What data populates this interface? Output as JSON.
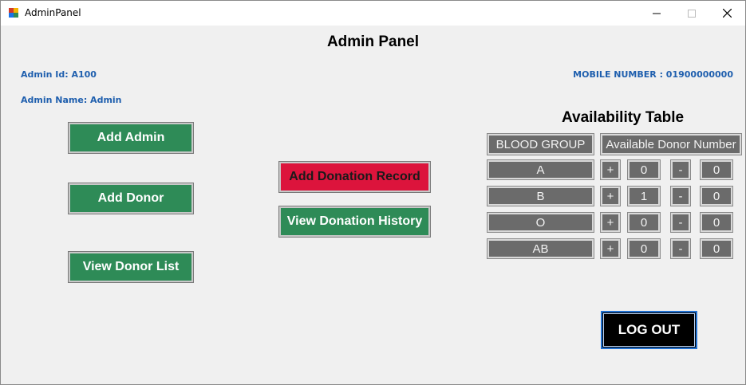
{
  "window": {
    "title": "AdminPanel"
  },
  "header": {
    "title": "Admin Panel"
  },
  "admin": {
    "id": "Admin Id: A100",
    "name": "Admin Name: Admin",
    "mobile": "MOBILE NUMBER : 01900000000"
  },
  "actions": {
    "add_admin": "Add Admin",
    "add_donor": "Add Donor",
    "view_donor_list": "View Donor List",
    "add_donation_record": "Add Donation Record",
    "view_donation_history": "View Donation History"
  },
  "availability": {
    "title": "Availability Table",
    "headers": [
      "BLOOD GROUP",
      "Available Donor Number"
    ],
    "plus": "+",
    "minus": "-",
    "rows": [
      {
        "group": "A",
        "count": "0",
        "value": "0"
      },
      {
        "group": "B",
        "count": "1",
        "value": "0"
      },
      {
        "group": "O",
        "count": "0",
        "value": "0"
      },
      {
        "group": "AB",
        "count": "0",
        "value": "0"
      }
    ]
  },
  "logout": "LOG OUT",
  "colors": {
    "green": "#2e8b57",
    "red": "#dc143c",
    "grey_cell": "#6b6b6b",
    "info_blue": "#1f5fae",
    "logout_border": "#1e6fd0"
  },
  "icons": {
    "app": "app-icon",
    "minimize": "minimize-icon",
    "maximize": "maximize-icon",
    "close": "close-icon"
  }
}
